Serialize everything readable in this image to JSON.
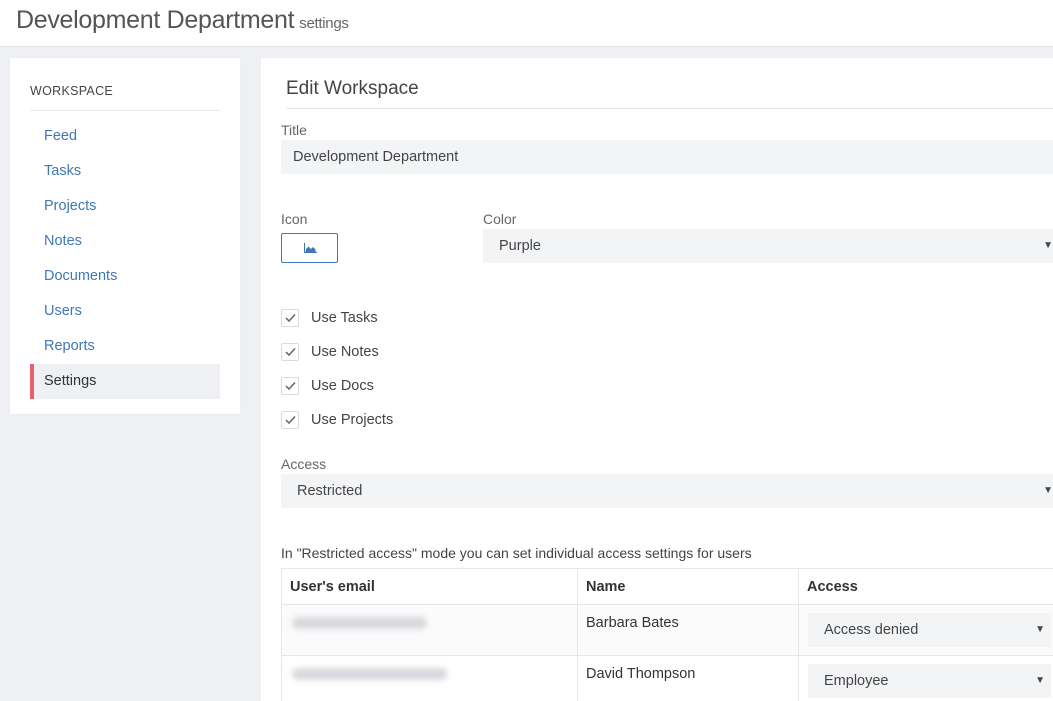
{
  "header": {
    "title": "Development Department",
    "subtitle": "settings"
  },
  "sidebar": {
    "heading": "WORKSPACE",
    "items": [
      {
        "label": "Feed"
      },
      {
        "label": "Tasks"
      },
      {
        "label": "Projects"
      },
      {
        "label": "Notes"
      },
      {
        "label": "Documents"
      },
      {
        "label": "Users"
      },
      {
        "label": "Reports"
      },
      {
        "label": "Settings",
        "active": true
      }
    ],
    "active_accent": "#e8606b"
  },
  "form": {
    "panel_title": "Edit Workspace",
    "title_label": "Title",
    "title_value": "Development Department",
    "icon_label": "Icon",
    "icon_name": "area-chart-icon",
    "color_label": "Color",
    "color_value": "Purple",
    "checkboxes": [
      {
        "label": "Use Tasks",
        "checked": true
      },
      {
        "label": "Use Notes",
        "checked": true
      },
      {
        "label": "Use Docs",
        "checked": true
      },
      {
        "label": "Use Projects",
        "checked": true
      }
    ],
    "access_label": "Access",
    "access_value": "Restricted",
    "restricted_note": "In \"Restricted access\" mode you can set individual access settings for users"
  },
  "users_table": {
    "columns": [
      "User's email",
      "Name",
      "Access"
    ],
    "rows": [
      {
        "email": "",
        "name": "Barbara Bates",
        "access": "Access denied"
      },
      {
        "email": "",
        "name": "David Thompson",
        "access": "Employee"
      }
    ]
  },
  "colors": {
    "link": "#3f78b4",
    "accent": "#e8606b",
    "field_bg": "#f3f4f6"
  }
}
